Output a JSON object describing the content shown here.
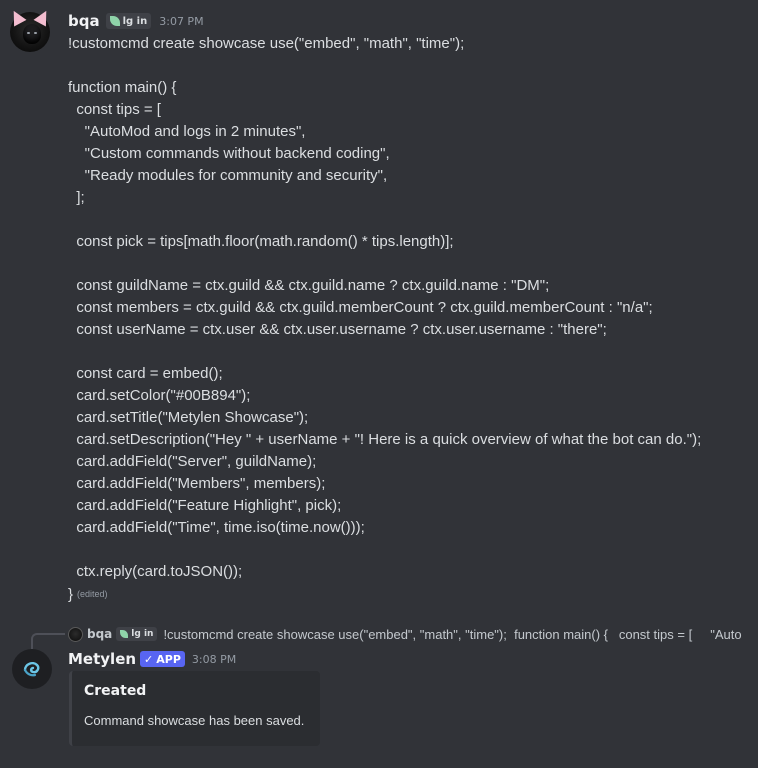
{
  "message1": {
    "author": "bqa",
    "tag_label": "lg in",
    "timestamp": "3:07 PM",
    "code": "!customcmd create showcase use(\"embed\", \"math\", \"time\");\n\nfunction main() {\n  const tips = [\n    \"AutoMod and logs in 2 minutes\",\n    \"Custom commands without backend coding\",\n    \"Ready modules for community and security\",\n  ];\n\n  const pick = tips[math.floor(math.random() * tips.length)];\n\n  const guildName = ctx.guild && ctx.guild.name ? ctx.guild.name : \"DM\";\n  const members = ctx.guild && ctx.guild.memberCount ? ctx.guild.memberCount : \"n/a\";\n  const userName = ctx.user && ctx.user.username ? ctx.user.username : \"there\";\n\n  const card = embed();\n  card.setColor(\"#00B894\");\n  card.setTitle(\"Metylen Showcase\");\n  card.setDescription(\"Hey \" + userName + \"! Here is a quick overview of what the bot can do.\");\n  card.addField(\"Server\", guildName);\n  card.addField(\"Members\", members);\n  card.addField(\"Feature Highlight\", pick);\n  card.addField(\"Time\", time.iso(time.now()));\n\n  ctx.reply(card.toJSON());",
    "closing_brace": "}",
    "edited_label": "(edited)"
  },
  "reply": {
    "author": "bqa",
    "tag_label": "lg in",
    "preview": "!customcmd create showcase use(\"embed\", \"math\", \"time\");  function main() {   const tips = [     \"Auto"
  },
  "message2": {
    "author": "Metylen",
    "badge_label": "APP",
    "timestamp": "3:08 PM",
    "embed": {
      "title": "Created",
      "description": "Command showcase has been saved."
    }
  },
  "colors": {
    "background": "#313338",
    "app_badge": "#5865f2",
    "embed_bg": "#2b2d31",
    "tag_leaf": "#8fd3a9"
  },
  "icons": {
    "user_avatar": "cat-ear-avatar-icon",
    "bot_avatar": "metylen-swirl-icon",
    "tag": "leaf-icon",
    "verified": "check-icon"
  }
}
